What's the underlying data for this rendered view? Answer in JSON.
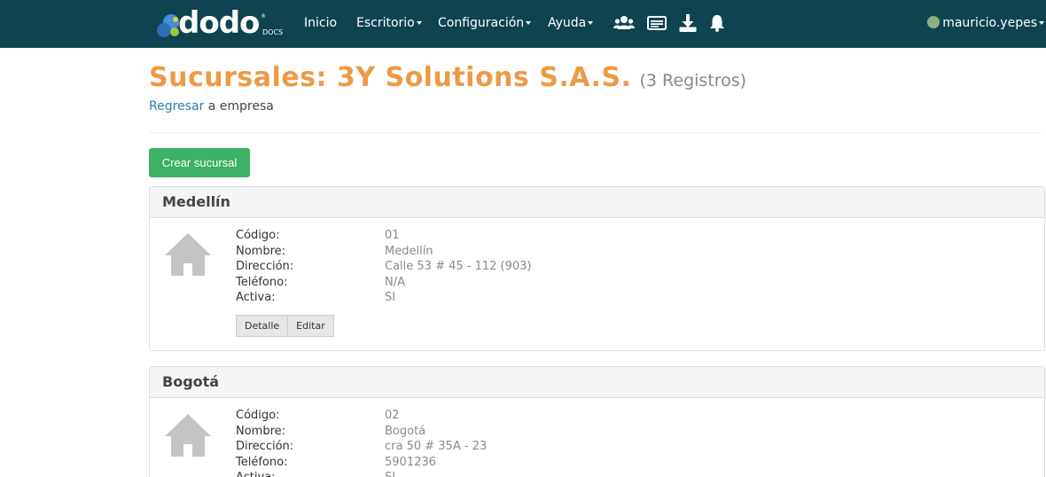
{
  "nav": {
    "logo_text": "dodo",
    "logo_sub": "DOCS",
    "logo_reg": "®",
    "items": [
      {
        "label": "Inicio"
      },
      {
        "label": "Escritorio"
      },
      {
        "label": "Configuración"
      },
      {
        "label": "Ayuda"
      }
    ],
    "icons": [
      "users-icon",
      "id-card-icon",
      "download-icon",
      "bell-icon"
    ],
    "user": "mauricio.yepes"
  },
  "header": {
    "title": "Sucursales: 3Y Solutions S.A.S.",
    "count": "(3 Registros)",
    "back_link": "Regresar",
    "back_suffix": " a empresa"
  },
  "create_button": "Crear sucursal",
  "field_labels": {
    "code": "Código:",
    "name": "Nombre:",
    "address": "Dirección:",
    "phone": "Teléfono:",
    "active": "Activa:"
  },
  "actions": {
    "detail": "Detalle",
    "edit": "Editar"
  },
  "branches": [
    {
      "title": "Medellín",
      "code": "01",
      "name": "Medellín",
      "address": "Calle 53 # 45 - 112 (903)",
      "phone": "N/A",
      "active": "SI"
    },
    {
      "title": "Bogotá",
      "code": "02",
      "name": "Bogotá",
      "address": "cra 50 # 35A - 23",
      "phone": "5901236",
      "active": "SI"
    }
  ],
  "colors": {
    "navbar": "#0d4450",
    "title": "#ed9a45",
    "create_button": "#3bb264",
    "link": "#2a7fb0"
  }
}
